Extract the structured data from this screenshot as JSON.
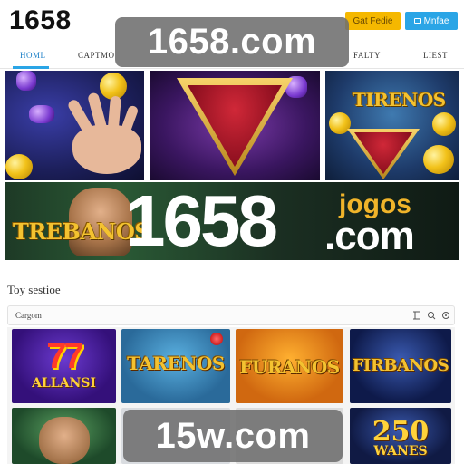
{
  "header": {
    "logo_text": "1658",
    "gold_button_label": "Gat Fedie",
    "blue_button_label": "Mnfae"
  },
  "nav": {
    "items": [
      {
        "label": "HOML",
        "active": true
      },
      {
        "label": "CAPTMO",
        "active": false
      },
      {
        "label": "FALTY",
        "active": false
      },
      {
        "label": "LIEST",
        "active": false
      }
    ]
  },
  "watermarks": {
    "top": "1658.com",
    "bottom": "15w.com"
  },
  "banners": {
    "right_panel_title": "TIRENOS",
    "big_left_title": "TREBANOS",
    "big_number": "1658",
    "big_suffix_top": "jogos",
    "big_suffix_bottom": ".com"
  },
  "section": {
    "title": "Toy sestioe",
    "filter_label": "Cargom",
    "controls": [
      "filter-icon",
      "search-icon",
      "settings-icon"
    ]
  },
  "games": [
    {
      "line1": "77",
      "line2": "ALLANSI"
    },
    {
      "title": "TARENOS"
    },
    {
      "title": "FURANOS"
    },
    {
      "title": "FIRBANOS"
    },
    {
      "title": ""
    },
    {
      "title": ""
    },
    {
      "title": ""
    },
    {
      "line1": "250",
      "line2": "WANES"
    }
  ],
  "colors": {
    "gold_button": "#f5b800",
    "blue_button": "#2aa5e6",
    "nav_active": "#1a7fc7",
    "title_gold": "#f4c230"
  }
}
